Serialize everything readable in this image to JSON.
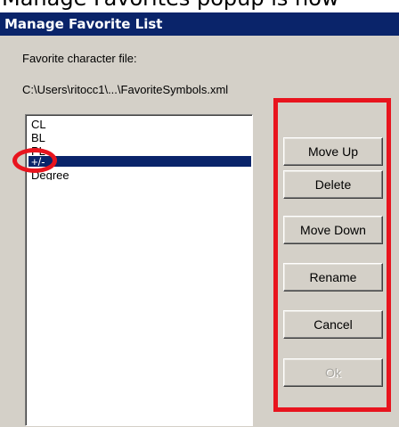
{
  "window": {
    "title": "Manage Favorite List"
  },
  "labels": {
    "file_label": "Favorite character file:",
    "file_path": "C:\\Users\\ritocc1\\...\\FavoriteSymbols.xml"
  },
  "favorites_list": {
    "items": [
      "CL",
      "BL",
      "PL",
      "+/-",
      "Degree"
    ],
    "selected_index": 3
  },
  "buttons": {
    "move_up": "Move Up",
    "delete": "Delete",
    "move_down": "Move Down",
    "rename": "Rename",
    "cancel": "Cancel",
    "ok": "Ok"
  },
  "colors": {
    "title_bar": "#0a246a",
    "selection": "#0a246a",
    "dialog_face": "#d4d0c8",
    "annotation_red": "#e8141e"
  }
}
